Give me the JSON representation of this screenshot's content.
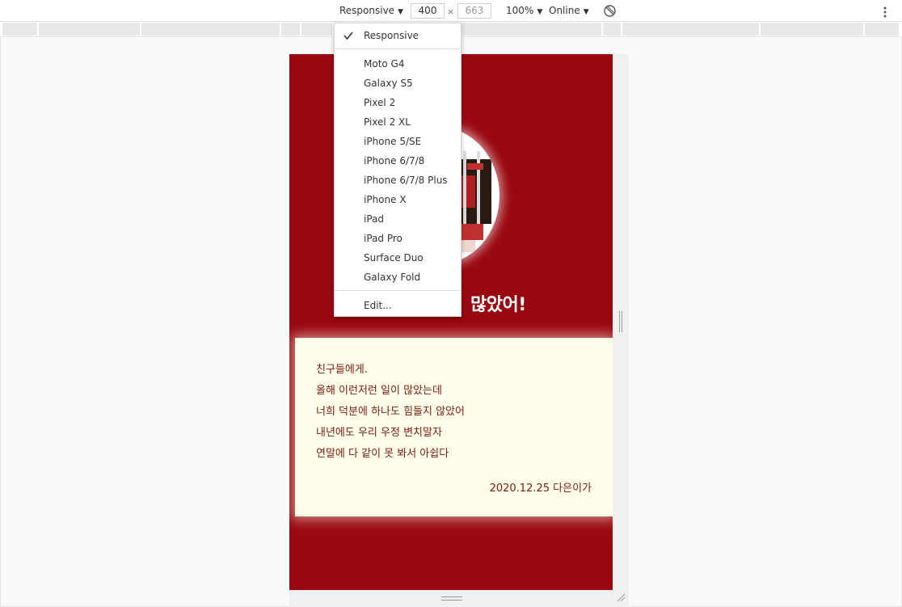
{
  "toolbar": {
    "device_label": "Responsive",
    "width_value": "400",
    "height_value": "663",
    "times": "×",
    "zoom_label": "100%",
    "network_label": "Online",
    "rotate_icon": "rotate-icon",
    "more_icon": "more-vertical-icon"
  },
  "device_menu": {
    "selected": "Responsive",
    "top_items": [
      "Responsive"
    ],
    "devices": [
      "Moto G4",
      "Galaxy S5",
      "Pixel 2",
      "Pixel 2 XL",
      "iPhone 5/SE",
      "iPhone 6/7/8",
      "iPhone 6/7/8 Plus",
      "iPhone X",
      "iPad",
      "iPad Pro",
      "Surface Duo",
      "Galaxy Fold"
    ],
    "edit_label": "Edit..."
  },
  "page": {
    "background_color": "#990810",
    "heading_visible": "많았어!",
    "letter": {
      "lines": [
        "친구들에게.",
        "올해 이런저런 일이 많았는데",
        "너희 덕분에 하나도 힘들지 않았어",
        "내년에도 우리 우정 변치말자",
        "연말에 다 같이 못 봐서 아쉽다"
      ],
      "signature": "2020.12.25 다은이가"
    }
  },
  "colors": {
    "accent_red": "#990810",
    "letter_bg": "#fffeeb",
    "letter_text": "#7a1a10"
  }
}
